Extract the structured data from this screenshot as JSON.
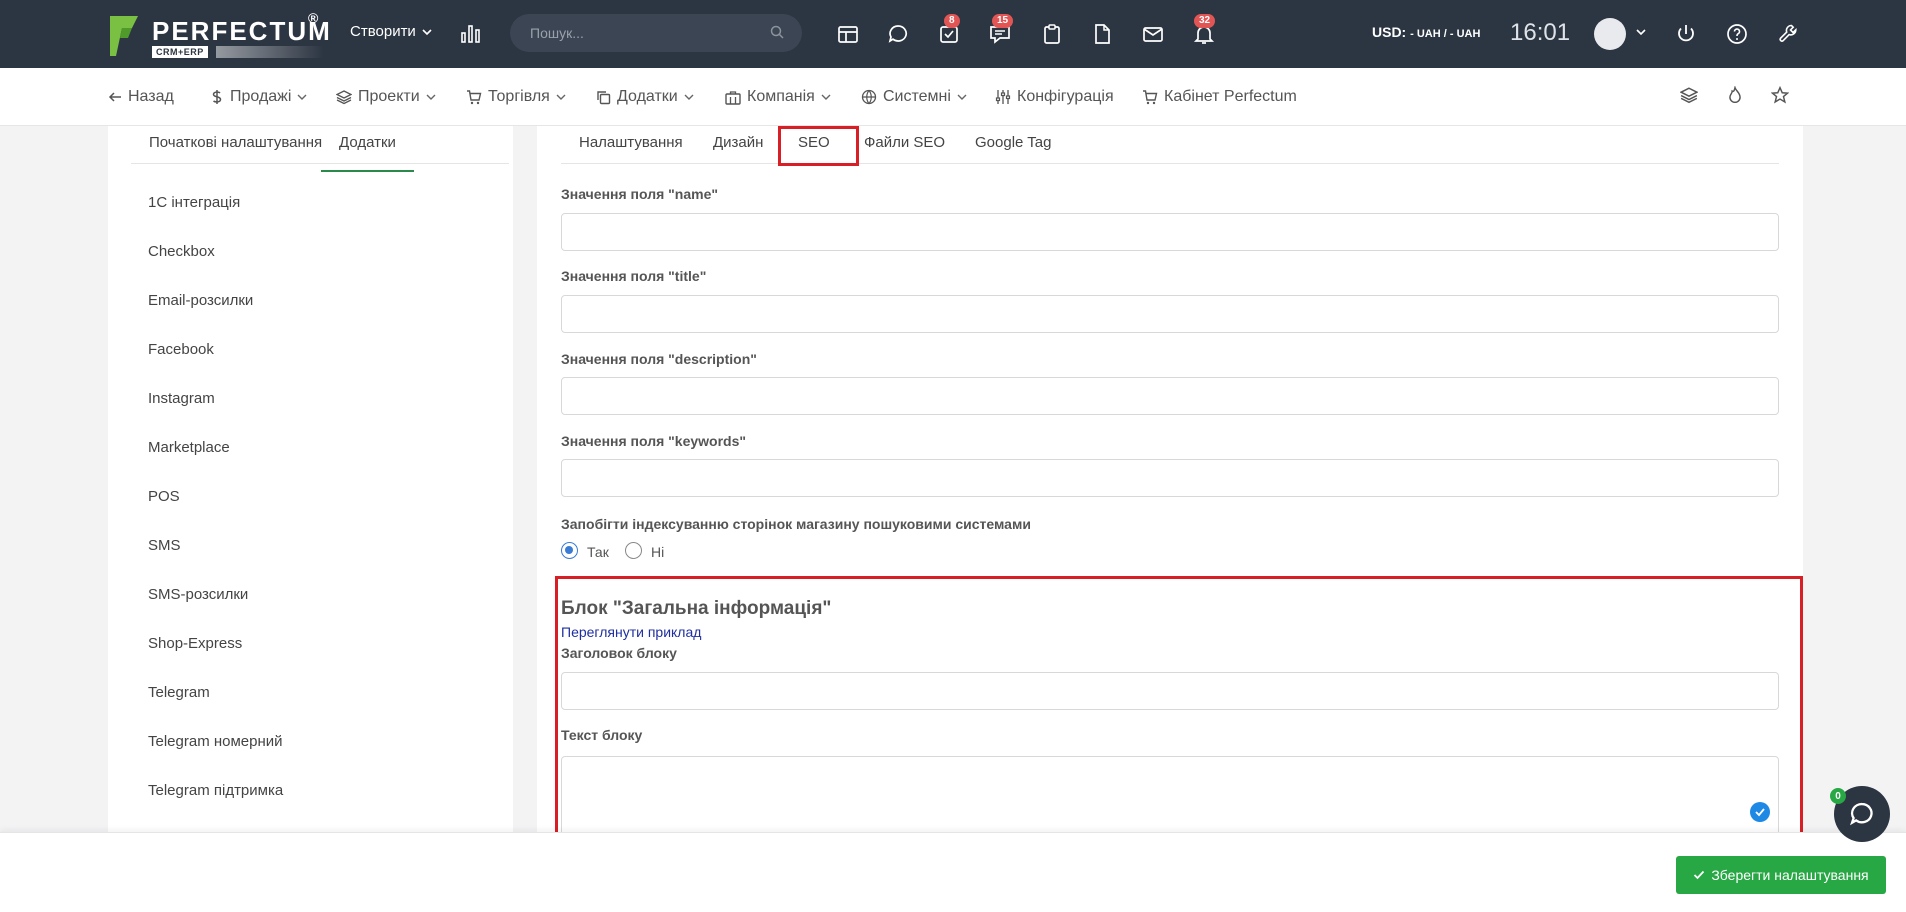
{
  "header": {
    "logo_text": "PERFECTUM",
    "logo_reg": "®",
    "logo_sub": "CRM+ERP",
    "create_label": "Створити",
    "search_placeholder": "Пошук...",
    "badges": {
      "tasks": "8",
      "chat": "15",
      "notifications": "32"
    },
    "currency_label": "USD:",
    "currency_rate": "- UAH / - UAH",
    "time": "16:01"
  },
  "nav": {
    "back": "Назад",
    "sales": "Продажі",
    "projects": "Проекти",
    "trade": "Торгівля",
    "addons": "Додатки",
    "company": "Компанія",
    "system": "Системні",
    "config": "Конфігурація",
    "cabinet": "Кабінет Perfectum"
  },
  "left": {
    "tabs": [
      "Початкові налаштування",
      "Додатки"
    ],
    "items": [
      "1С інтеграція",
      "Checkbox",
      "Email-розсилки",
      "Facebook",
      "Instagram",
      "Marketplace",
      "POS",
      "SMS",
      "SMS-розсилки",
      "Shop-Express",
      "Telegram",
      "Telegram номерний",
      "Telegram підтримка"
    ]
  },
  "main": {
    "tabs": [
      "Налаштування",
      "Дизайн",
      "SEO",
      "Файли SEO",
      "Google Tag"
    ],
    "fields": {
      "name_label": "Значення поля \"name\"",
      "title_label": "Значення поля \"title\"",
      "description_label": "Значення поля \"description\"",
      "keywords_label": "Значення поля \"keywords\""
    },
    "index_question": "Запобігти індексуванню сторінок магазину пошуковими системами",
    "radio_yes": "Так",
    "radio_no": "Ні",
    "block_title": "Блок \"Загальна інформація\"",
    "block_link": "Переглянути приклад",
    "block_heading_label": "Заголовок блоку",
    "block_text_label": "Текст блоку"
  },
  "footer": {
    "save_label": "Зберегти налаштування",
    "chat_count": "0"
  },
  "colors": {
    "header_bg": "#2c3542",
    "accent_green": "#28a745",
    "highlight_red": "#d81f26",
    "badge_red": "#e25555"
  }
}
